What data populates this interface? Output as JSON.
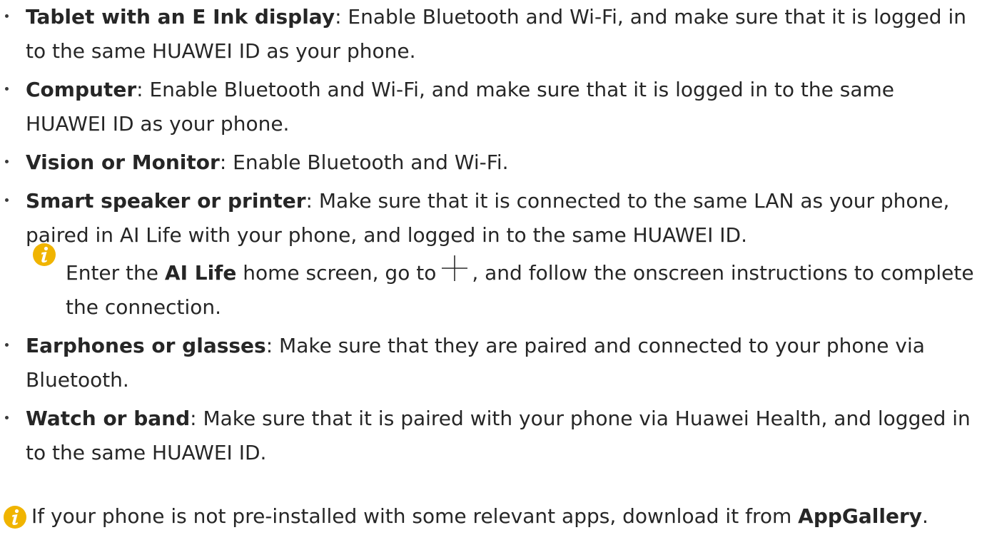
{
  "items": [
    {
      "term": "Tablet with an E Ink display",
      "text": ": Enable Bluetooth and Wi-Fi, and make sure that it is logged in to the same HUAWEI ID as your phone."
    },
    {
      "term": "Computer",
      "text": ": Enable Bluetooth and Wi-Fi, and make sure that it is logged in to the same HUAWEI ID as your phone."
    },
    {
      "term": "Vision or Monitor",
      "text": ": Enable Bluetooth and Wi-Fi."
    },
    {
      "term": "Smart speaker or printer",
      "text": ": Make sure that it is connected to the same LAN as your phone, paired in AI Life with your phone, and logged in to the same HUAWEI ID."
    },
    {
      "term": "Earphones or glasses",
      "text": ": Make sure that they are paired and connected to your phone via Bluetooth."
    },
    {
      "term": "Watch or band",
      "text": ": Make sure that it is paired with your phone via Huawei Health, and logged in to the same HUAWEI ID."
    }
  ],
  "note": {
    "prefix": "Enter the ",
    "app": "AI Life",
    "middle": " home screen, go to",
    "suffix": ", and follow the onscreen instructions to complete the connection.",
    "icon": "plus-icon"
  },
  "footnote": {
    "text": "If your phone is not pre-installed with some relevant apps, download it from ",
    "store": "AppGallery",
    "end": "."
  },
  "icons": {
    "info": "info-icon",
    "info_color": "#f0b400"
  }
}
